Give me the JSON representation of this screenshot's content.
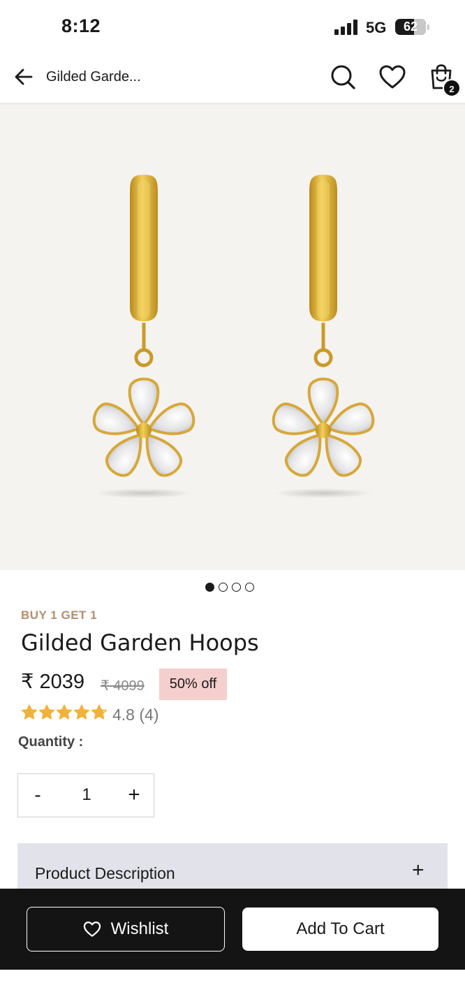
{
  "status_bar": {
    "time": "8:12",
    "network": "5G",
    "battery_level": "62",
    "battery_fraction": 0.62
  },
  "header": {
    "title": "Gilded Garde...",
    "cart_count": "2"
  },
  "gallery": {
    "total_images": 4,
    "active_index": 0
  },
  "product": {
    "promo_tag": "BUY 1 GET 1",
    "title": "Gilded Garden Hoops",
    "price": "₹ 2039",
    "mrp": "₹ 4099",
    "discount": "50% off",
    "rating_value": 4.8,
    "rating_text": "4.8 (4)",
    "quantity_label": "Quantity :",
    "quantity": "1",
    "description_label": "Product Description"
  },
  "stepper": {
    "minus": "-",
    "plus": "+"
  },
  "accordion": {
    "expand_icon": "+"
  },
  "actions": {
    "wishlist_label": "Wishlist",
    "add_to_cart_label": "Add To Cart"
  },
  "colors": {
    "promo": "#b58e6e",
    "discount_bg": "#f5cfcd",
    "star": "#f0b23c",
    "bottom_bar": "#141414",
    "accordion_bg": "#e2e3ea",
    "gold": "#d9a82d"
  },
  "icons": {
    "back": "arrow-left-icon",
    "search": "search-icon",
    "wishlist": "heart-icon",
    "cart": "shopping-bag-icon",
    "star": "star-icon"
  }
}
